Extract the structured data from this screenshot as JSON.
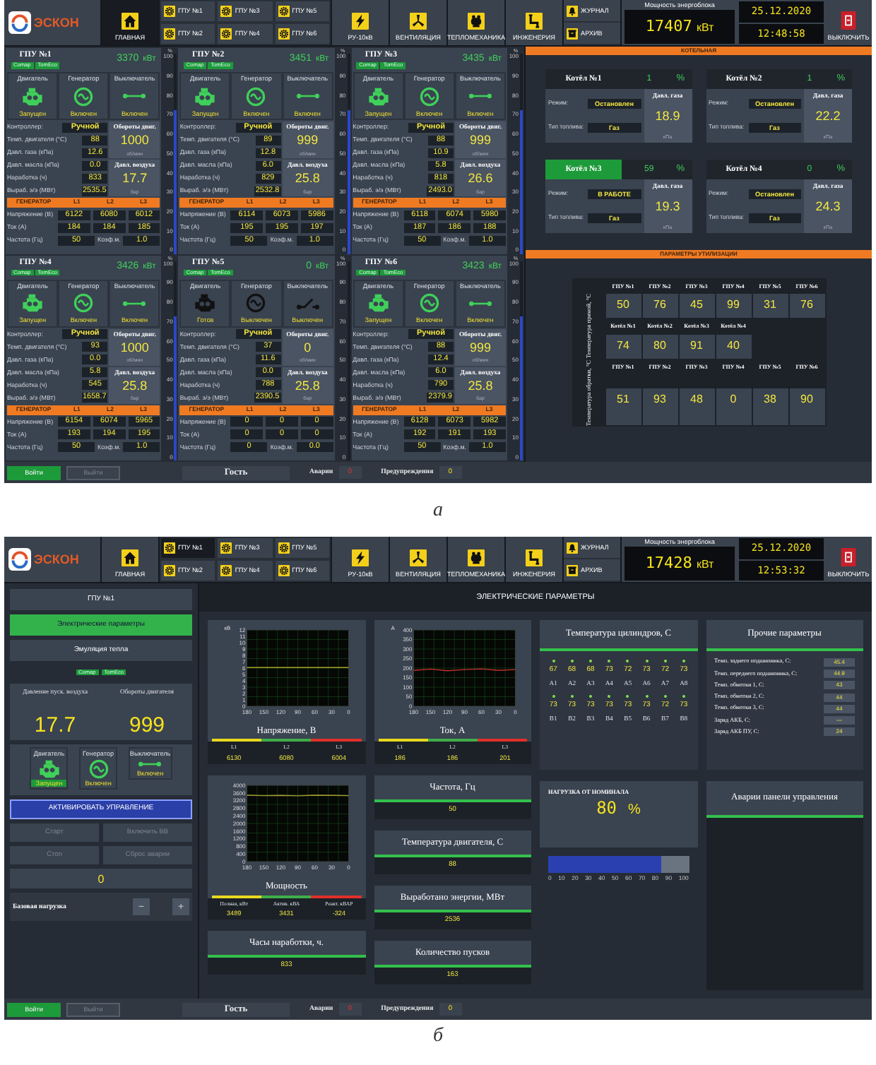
{
  "screen_a": {
    "header": {
      "logo": "ЭСКОН",
      "home": {
        "label": "ГЛАВНАЯ",
        "selected": true
      },
      "gpu_links": [
        {
          "label": "ГПУ №1",
          "selected": false
        },
        {
          "label": "ГПУ №3",
          "selected": false
        },
        {
          "label": "ГПУ №5",
          "selected": false
        },
        {
          "label": "ГПУ №2",
          "selected": false
        },
        {
          "label": "ГПУ №4",
          "selected": false
        },
        {
          "label": "ГПУ №6",
          "selected": false
        }
      ],
      "sections": [
        {
          "kind": "bolt",
          "label": "РУ-10кВ"
        },
        {
          "kind": "fan",
          "label": "ВЕНТИЛЯЦИЯ"
        },
        {
          "kind": "boiler",
          "label": "ТЕПЛОМЕХАНИКА"
        },
        {
          "kind": "pipe",
          "label": "ИНЖЕНЕРИЯ"
        }
      ],
      "logs": [
        {
          "kind": "bell",
          "label": "ЖУРНАЛ"
        },
        {
          "kind": "archive",
          "label": "АРХИВ"
        }
      ],
      "power": {
        "label": "Мощность энергоблока",
        "value": "17407",
        "unit": "кВт"
      },
      "date": "25.12.2020",
      "time": "12:48:58",
      "shutdown": "ВЫКЛЮЧИТЬ"
    },
    "gpus": [
      {
        "title": "ГПУ №1",
        "power": "3370",
        "unit": "кВт",
        "tags": [
          "Comap",
          "TomEco"
        ],
        "devices": [
          {
            "kind": "engine",
            "label": "Двигатель",
            "status": "Запущен",
            "active": true
          },
          {
            "kind": "generator",
            "label": "Генератор",
            "status": "Включен",
            "active": true
          },
          {
            "kind": "breaker",
            "label": "Выключатель",
            "status": "Включен",
            "active": true
          }
        ],
        "controller": {
          "label": "Контроллер:",
          "value": "Ручной"
        },
        "params": [
          {
            "label": "Темп. двигателя (°C)",
            "value": "88"
          },
          {
            "label": "Давл. газа (кПа)",
            "value": "12.6"
          },
          {
            "label": "Давл. масла (кПа)",
            "value": "0.0"
          },
          {
            "label": "Наработка (ч)",
            "value": "833"
          },
          {
            "label": "Выраб. э/э (МВт)",
            "value": "2535.5"
          }
        ],
        "side": [
          {
            "label": "Обороты двиг.",
            "value": "1000",
            "unit": "об/мин"
          },
          {
            "label": "Давл. воздуха",
            "value": "17.7",
            "unit": "бар"
          }
        ],
        "generator": [
          "ГЕНЕРАТОР",
          "L1",
          "L2",
          "L3"
        ],
        "lines": [
          {
            "label": "Напряжение (В)",
            "values": [
              "6122",
              "6080",
              "6012"
            ]
          },
          {
            "label": "Ток (А)",
            "values": [
              "184",
              "184",
              "185"
            ]
          }
        ],
        "freq": {
          "label": "Частота (Гц)",
          "value": "50",
          "coef_label": "Коэф.м.",
          "coef": "1.0"
        },
        "scale": {
          "unit": "%",
          "ticks": [
            "100",
            "90",
            "80",
            "70",
            "60",
            "50",
            "40",
            "30",
            "20",
            "10",
            "0"
          ],
          "level": 0.72
        }
      },
      {
        "title": "ГПУ №2",
        "power": "3451",
        "unit": "кВт",
        "tags": [
          "Comap",
          "TomEco"
        ],
        "devices": [
          {
            "kind": "engine",
            "label": "Двигатель",
            "status": "Запущен",
            "active": true
          },
          {
            "kind": "generator",
            "label": "Генератор",
            "status": "Включен",
            "active": true
          },
          {
            "kind": "breaker",
            "label": "Выключатель",
            "status": "Включен",
            "active": true
          }
        ],
        "controller": {
          "label": "Контроллер:",
          "value": "Ручной"
        },
        "params": [
          {
            "label": "Темп. двигателя (°C)",
            "value": "89"
          },
          {
            "label": "Давл. газа (кПа)",
            "value": "12.8"
          },
          {
            "label": "Давл. масла (кПа)",
            "value": "6.0"
          },
          {
            "label": "Наработка (ч)",
            "value": "829"
          },
          {
            "label": "Выраб. э/э (МВт)",
            "value": "2532.8"
          }
        ],
        "side": [
          {
            "label": "Обороты двиг.",
            "value": "999",
            "unit": "об/мин"
          },
          {
            "label": "Давл. воздуха",
            "value": "25.8",
            "unit": "бар"
          }
        ],
        "generator": [
          "ГЕНЕРАТОР",
          "L1",
          "L2",
          "L3"
        ],
        "lines": [
          {
            "label": "Напряжение (В)",
            "values": [
              "6114",
              "6073",
              "5986"
            ]
          },
          {
            "label": "Ток (А)",
            "values": [
              "195",
              "195",
              "197"
            ]
          }
        ],
        "freq": {
          "label": "Частота (Гц)",
          "value": "50",
          "coef_label": "Коэф.м.",
          "coef": "1.0"
        },
        "scale": {
          "unit": "%",
          "ticks": [
            "100",
            "90",
            "80",
            "70",
            "60",
            "50",
            "40",
            "30",
            "20",
            "10",
            "0"
          ],
          "level": 0.72
        }
      },
      {
        "title": "ГПУ №3",
        "power": "3435",
        "unit": "кВт",
        "tags": [
          "Comap",
          "TomEco"
        ],
        "devices": [
          {
            "kind": "engine",
            "label": "Двигатель",
            "status": "Запущен",
            "active": true
          },
          {
            "kind": "generator",
            "label": "Генератор",
            "status": "Включен",
            "active": true
          },
          {
            "kind": "breaker",
            "label": "Выключатель",
            "status": "Включен",
            "active": true
          }
        ],
        "controller": {
          "label": "Контроллер:",
          "value": "Ручной"
        },
        "params": [
          {
            "label": "Темп. двигателя (°C)",
            "value": "88"
          },
          {
            "label": "Давл. газа (кПа)",
            "value": "10.9"
          },
          {
            "label": "Давл. масла (кПа)",
            "value": "5.8"
          },
          {
            "label": "Наработка (ч)",
            "value": "818"
          },
          {
            "label": "Выраб. э/э (МВт)",
            "value": "2493.0"
          }
        ],
        "side": [
          {
            "label": "Обороты двиг.",
            "value": "999",
            "unit": "об/мин"
          },
          {
            "label": "Давл. воздуха",
            "value": "26.6",
            "unit": "бар"
          }
        ],
        "generator": [
          "ГЕНЕРАТОР",
          "L1",
          "L2",
          "L3"
        ],
        "lines": [
          {
            "label": "Напряжение (В)",
            "values": [
              "6118",
              "6074",
              "5980"
            ]
          },
          {
            "label": "Ток (А)",
            "values": [
              "187",
              "186",
              "188"
            ]
          }
        ],
        "freq": {
          "label": "Частота (Гц)",
          "value": "50",
          "coef_label": "Коэф.м.",
          "coef": "1.0"
        },
        "scale": {
          "unit": "%",
          "ticks": [
            "100",
            "90",
            "80",
            "70",
            "60",
            "50",
            "40",
            "30",
            "20",
            "10",
            "0"
          ],
          "level": 0.72
        }
      },
      {
        "title": "ГПУ №4",
        "power": "3426",
        "unit": "кВт",
        "tags": [
          "Comap",
          "TomEco"
        ],
        "devices": [
          {
            "kind": "engine",
            "label": "Двигатель",
            "status": "Запущен",
            "active": true
          },
          {
            "kind": "generator",
            "label": "Генератор",
            "status": "Включен",
            "active": true
          },
          {
            "kind": "breaker",
            "label": "Выключатель",
            "status": "Включен",
            "active": true
          }
        ],
        "controller": {
          "label": "Контроллер:",
          "value": "Ручной"
        },
        "params": [
          {
            "label": "Темп. двигателя (°C)",
            "value": "93"
          },
          {
            "label": "Давл. газа (кПа)",
            "value": "0.0"
          },
          {
            "label": "Давл. масла (кПа)",
            "value": "5.8"
          },
          {
            "label": "Наработка (ч)",
            "value": "545"
          },
          {
            "label": "Выраб. э/э (МВт)",
            "value": "1658.7"
          }
        ],
        "side": [
          {
            "label": "Обороты двиг.",
            "value": "1000",
            "unit": "об/мин"
          },
          {
            "label": "Давл. воздуха",
            "value": "25.8",
            "unit": "бар"
          }
        ],
        "generator": [
          "ГЕНЕРАТОР",
          "L1",
          "L2",
          "L3"
        ],
        "lines": [
          {
            "label": "Напряжение (В)",
            "values": [
              "6154",
              "6074",
              "5965"
            ]
          },
          {
            "label": "Ток (А)",
            "values": [
              "193",
              "194",
              "195"
            ]
          }
        ],
        "freq": {
          "label": "Частота (Гц)",
          "value": "50",
          "coef_label": "Коэф.м.",
          "coef": "1.0"
        },
        "scale": {
          "unit": "%",
          "ticks": [
            "100",
            "90",
            "80",
            "70",
            "60",
            "50",
            "40",
            "30",
            "20",
            "10",
            "0"
          ],
          "level": 0.72
        }
      },
      {
        "title": "ГПУ №5",
        "power": "0",
        "unit": "кВт",
        "tags": [
          "Comap",
          "TomEco"
        ],
        "devices": [
          {
            "kind": "engine",
            "label": "Двигатель",
            "status": "Готов",
            "active": false
          },
          {
            "kind": "generator",
            "label": "Генератор",
            "status": "Выключен",
            "active": false
          },
          {
            "kind": "breaker",
            "label": "Выключатель",
            "status": "Выключен",
            "active": false
          }
        ],
        "controller": {
          "label": "Контроллер:",
          "value": "Ручной"
        },
        "params": [
          {
            "label": "Темп. двигателя (°C)",
            "value": "37"
          },
          {
            "label": "Давл. газа (кПа)",
            "value": "11.6"
          },
          {
            "label": "Давл. масла (кПа)",
            "value": "0.0"
          },
          {
            "label": "Наработка (ч)",
            "value": "788"
          },
          {
            "label": "Выраб. э/э (МВт)",
            "value": "2390.5"
          }
        ],
        "side": [
          {
            "label": "Обороты двиг.",
            "value": "0",
            "unit": "об/мин"
          },
          {
            "label": "Давл. воздуха",
            "value": "25.8",
            "unit": "бар"
          }
        ],
        "generator": [
          "ГЕНЕРАТОР",
          "L1",
          "L2",
          "L3"
        ],
        "lines": [
          {
            "label": "Напряжение (В)",
            "values": [
              "0",
              "0",
              "0"
            ]
          },
          {
            "label": "Ток (А)",
            "values": [
              "0",
              "0",
              "0"
            ]
          }
        ],
        "freq": {
          "label": "Частота (Гц)",
          "value": "0",
          "coef_label": "Коэф.м.",
          "coef": "0.0"
        },
        "scale": {
          "unit": "%",
          "ticks": [
            "100",
            "90",
            "80",
            "70",
            "60",
            "50",
            "40",
            "30",
            "20",
            "10",
            "0"
          ],
          "level": 0
        }
      },
      {
        "title": "ГПУ №6",
        "power": "3423",
        "unit": "кВт",
        "tags": [
          "Comap",
          "TomEco"
        ],
        "devices": [
          {
            "kind": "engine",
            "label": "Двигатель",
            "status": "Запущен",
            "active": true
          },
          {
            "kind": "generator",
            "label": "Генератор",
            "status": "Включен",
            "active": true
          },
          {
            "kind": "breaker",
            "label": "Выключатель",
            "status": "Включен",
            "active": true
          }
        ],
        "controller": {
          "label": "Контроллер:",
          "value": "Ручной"
        },
        "params": [
          {
            "label": "Темп. двигателя (°C)",
            "value": "88"
          },
          {
            "label": "Давл. газа (кПа)",
            "value": "12.4"
          },
          {
            "label": "Давл. масла (кПа)",
            "value": "6.0"
          },
          {
            "label": "Наработка (ч)",
            "value": "790"
          },
          {
            "label": "Выраб. э/э (МВт)",
            "value": "2379.9"
          }
        ],
        "side": [
          {
            "label": "Обороты двиг.",
            "value": "999",
            "unit": "об/мин"
          },
          {
            "label": "Давл. воздуха",
            "value": "25.8",
            "unit": "бар"
          }
        ],
        "generator": [
          "ГЕНЕРАТОР",
          "L1",
          "L2",
          "L3"
        ],
        "lines": [
          {
            "label": "Напряжение (В)",
            "values": [
              "6128",
              "6073",
              "5982"
            ]
          },
          {
            "label": "Ток (А)",
            "values": [
              "192",
              "191",
              "193"
            ]
          }
        ],
        "freq": {
          "label": "Частота (Гц)",
          "value": "50",
          "coef_label": "Коэф.м.",
          "coef": "1.0"
        },
        "scale": {
          "unit": "%",
          "ticks": [
            "100",
            "90",
            "80",
            "70",
            "60",
            "50",
            "40",
            "30",
            "20",
            "10",
            "0"
          ],
          "level": 0.72
        }
      }
    ],
    "boiler_room": {
      "title": "КОТЕЛЬНАЯ",
      "boilers": [
        {
          "name": "Котёл №1",
          "value": "1",
          "unit": "%",
          "running": false,
          "rows": [
            {
              "label": "Режим:",
              "value": "Остановлен"
            },
            {
              "label": "Тип топлива:",
              "value": "Газ"
            }
          ],
          "gas": {
            "label": "Давл. газа",
            "value": "18.9",
            "unit": "кПа"
          }
        },
        {
          "name": "Котёл №2",
          "value": "1",
          "unit": "%",
          "running": false,
          "rows": [
            {
              "label": "Режим:",
              "value": "Остановлен"
            },
            {
              "label": "Тип топлива:",
              "value": "Газ"
            }
          ],
          "gas": {
            "label": "Давл. газа",
            "value": "22.2",
            "unit": "кПа"
          }
        },
        {
          "name": "Котёл №3",
          "value": "59",
          "unit": "%",
          "running": true,
          "rows": [
            {
              "label": "Режим:",
              "value": "В РАБОТЕ"
            },
            {
              "label": "Тип топлива:",
              "value": "Газ"
            }
          ],
          "gas": {
            "label": "Давл. газа",
            "value": "19.3",
            "unit": "кПа"
          }
        },
        {
          "name": "Котёл №4",
          "value": "0",
          "unit": "%",
          "running": false,
          "rows": [
            {
              "label": "Режим:",
              "value": "Остановлен"
            },
            {
              "label": "Тип топлива:",
              "value": "Газ"
            }
          ],
          "gas": {
            "label": "Давл. газа",
            "value": "24.3",
            "unit": "кПа"
          }
        }
      ]
    },
    "utilization": {
      "title": "ПАРАМЕТРЫ УТИЛИЗАЦИИ",
      "supply": {
        "label": "Температура прямой, °С",
        "gpu_headers": [
          "ГПУ №1",
          "ГПУ №2",
          "ГПУ №3",
          "ГПУ №4",
          "ГПУ №5",
          "ГПУ №6"
        ],
        "gpu_values": [
          "50",
          "76",
          "45",
          "99",
          "31",
          "76"
        ],
        "boiler_headers": [
          "Котёл №1",
          "Котёл №2",
          "Котёл №3",
          "Котёл №4"
        ],
        "boiler_values": [
          "74",
          "80",
          "91",
          "40"
        ]
      },
      "return": {
        "label": "Температура обратки, °С",
        "gpu_headers": [
          "ГПУ №1",
          "ГПУ №2",
          "ГПУ №3",
          "ГПУ №4",
          "ГПУ №5",
          "ГПУ №6"
        ],
        "gpu_values": [
          "51",
          "93",
          "48",
          "0",
          "38",
          "90"
        ]
      }
    },
    "footer": {
      "login": {
        "label": "Войти",
        "disabled": false
      },
      "logout": {
        "label": "Выйти",
        "disabled": true
      },
      "user": "Гость",
      "alarms": {
        "label": "Аварии",
        "value": "0"
      },
      "warnings": {
        "label": "Предупреждения",
        "value": "0"
      }
    },
    "caption": "а"
  },
  "screen_b": {
    "header": {
      "logo": "ЭСКОН",
      "home": {
        "label": "ГЛАВНАЯ",
        "selected": false
      },
      "gpu_links": [
        {
          "label": "ГПУ №1",
          "selected": true
        },
        {
          "label": "ГПУ №3",
          "selected": false
        },
        {
          "label": "ГПУ №5",
          "selected": false
        },
        {
          "label": "ГПУ №2",
          "selected": false
        },
        {
          "label": "ГПУ №4",
          "selected": false
        },
        {
          "label": "ГПУ №6",
          "selected": false
        }
      ],
      "sections": [
        {
          "kind": "bolt",
          "label": "РУ-10кВ"
        },
        {
          "kind": "fan",
          "label": "ВЕНТИЛЯЦИЯ"
        },
        {
          "kind": "boiler",
          "label": "ТЕПЛОМЕХАНИКА"
        },
        {
          "kind": "pipe",
          "label": "ИНЖЕНЕРИЯ"
        }
      ],
      "logs": [
        {
          "kind": "bell",
          "label": "ЖУРНАЛ"
        },
        {
          "kind": "archive",
          "label": "АРХИВ"
        }
      ],
      "power": {
        "label": "Мощность энергоблока",
        "value": "17428",
        "unit": "кВт"
      },
      "date": "25.12.2020",
      "time": "12:53:32",
      "shutdown": "ВЫКЛЮЧИТЬ"
    },
    "left": {
      "title": "ГПУ №1",
      "tabs": [
        {
          "label": "Электрические параметры",
          "selected": true
        },
        {
          "label": "Эмуляция тепла",
          "selected": false
        }
      ],
      "tags": [
        "Comap",
        "TomEco"
      ],
      "readings": [
        {
          "label": "Давление пуск. воздуха",
          "value": "17.7"
        },
        {
          "label": "Обороты двигателя",
          "value": "999"
        }
      ],
      "devices": [
        {
          "kind": "engine",
          "label": "Двигатель",
          "status": "Запущен",
          "active": true,
          "highlighted": true
        },
        {
          "kind": "generator",
          "label": "Генератор",
          "status": "Включен",
          "active": true,
          "highlighted": false
        },
        {
          "kind": "breaker",
          "label": "Выключатель",
          "status": "Включен",
          "active": true,
          "highlighted": false
        }
      ],
      "activate": "АКТИВИРОВАТЬ УПРАВЛЕНИЕ",
      "controls": [
        {
          "label": "Старт",
          "disabled": true
        },
        {
          "label": "Включить ВВ",
          "disabled": true
        },
        {
          "label": "Стоп",
          "disabled": true
        },
        {
          "label": "Сброс аварии",
          "disabled": true
        }
      ],
      "setpoint": "0",
      "base_load": {
        "label": "Базовая нагрузка",
        "minus": "−",
        "plus": "+"
      }
    },
    "main": {
      "title": "ЭЛЕКТРИЧЕСКИЕ ПАРАМЕТРЫ",
      "column_1": [
        {
          "kind": "chart",
          "title": "Напряжение, В",
          "chart_data": {
            "type": "line",
            "grid": true,
            "ylabel": "кВ",
            "x": [
              180,
              150,
              120,
              90,
              60,
              30,
              0
            ],
            "xlim": [
              180,
              0
            ],
            "ylim": [
              0,
              12
            ],
            "xticks": [
              180,
              150,
              120,
              90,
              60,
              30,
              0
            ],
            "yticks": [
              0,
              1,
              2,
              3,
              4,
              5,
              6,
              7,
              8,
              9,
              10,
              11,
              12
            ],
            "series": [
              {
                "color": "#c8c02a",
                "values": [
                  6.1,
                  6.1,
                  6.1,
                  6.1,
                  6.1,
                  6.1,
                  6.1
                ]
              }
            ]
          },
          "legend": [
            {
              "label": "L1",
              "value": "6130",
              "color": "#e8d81e"
            },
            {
              "label": "L2",
              "value": "6080",
              "color": "#3fae49"
            },
            {
              "label": "L3",
              "value": "6004",
              "color": "#e0302a"
            }
          ]
        },
        {
          "kind": "chart",
          "title": "Мощность",
          "chart_data": {
            "type": "line",
            "grid": true,
            "x": [
              180,
              150,
              120,
              90,
              60,
              30,
              0
            ],
            "xlim": [
              180,
              0
            ],
            "ylim": [
              0,
              4000
            ],
            "xticks": [
              180,
              150,
              120,
              90,
              60,
              30,
              0
            ],
            "yticks": [
              0,
              400,
              800,
              1200,
              1600,
              2000,
              2400,
              2800,
              3200,
              3600,
              4000
            ],
            "series": [
              {
                "color": "#a89a30",
                "values": [
                  3480,
                  3460,
                  3470,
                  3450,
                  3480,
                  3470,
                  3460
                ]
              }
            ]
          },
          "legend": [
            {
              "label": "Полная, кВт",
              "value": "3489",
              "color": "#e8d81e"
            },
            {
              "label": "Актив. кВА",
              "value": "3431",
              "color": "#3fae49"
            },
            {
              "label": "Реакт. кВАР",
              "value": "-324",
              "color": "#e0302a"
            }
          ]
        },
        {
          "kind": "tile",
          "title": "Часы наработки, ч.",
          "value": "833"
        }
      ],
      "column_2": [
        {
          "kind": "chart",
          "title": "Ток, А",
          "chart_data": {
            "type": "line",
            "grid": true,
            "ylabel": "А",
            "x": [
              180,
              150,
              120,
              90,
              60,
              30,
              0
            ],
            "xlim": [
              180,
              0
            ],
            "ylim": [
              0,
              400
            ],
            "xticks": [
              180,
              150,
              120,
              90,
              60,
              30,
              0
            ],
            "yticks": [
              0,
              50,
              100,
              150,
              200,
              250,
              300,
              350,
              400
            ],
            "series": [
              {
                "color": "#c8302a",
                "values": [
                  188,
                  195,
                  186,
                  192,
                  196,
                  188,
                  192
                ]
              }
            ]
          },
          "legend": [
            {
              "label": "L1",
              "value": "186",
              "color": "#e8d81e"
            },
            {
              "label": "L2",
              "value": "186",
              "color": "#3fae49"
            },
            {
              "label": "L3",
              "value": "201",
              "color": "#e0302a"
            }
          ]
        },
        {
          "kind": "tile",
          "title": "Частота, Гц",
          "value": "50"
        },
        {
          "kind": "tile",
          "title": "Температура двигателя, С",
          "value": "88"
        },
        {
          "kind": "tile",
          "title": "Выработано энергии, МВт",
          "value": "2536"
        },
        {
          "kind": "tile",
          "title": "Количество пусков",
          "value": "163"
        }
      ],
      "cylinders": {
        "title": "Температура цилиндров, С",
        "rows": [
          {
            "values": [
              "67",
              "68",
              "68",
              "73",
              "72",
              "73",
              "72",
              "73"
            ],
            "labels": [
              "A1",
              "A2",
              "A3",
              "A4",
              "A5",
              "A6",
              "A7",
              "A8"
            ]
          },
          {
            "values": [
              "73",
              "73",
              "73",
              "73",
              "73",
              "73",
              "72",
              "73"
            ],
            "labels": [
              "B1",
              "B2",
              "B3",
              "B4",
              "B5",
              "B6",
              "B7",
              "B8"
            ]
          }
        ]
      },
      "load": {
        "title": "НАГРУЗКА ОТ НОМИНАЛА",
        "value": "80",
        "unit": "%",
        "level": 0.8,
        "ticks": [
          "0",
          "10",
          "20",
          "30",
          "40",
          "50",
          "60",
          "70",
          "80",
          "90",
          "100"
        ]
      },
      "other": {
        "title": "Прочие параметры",
        "rows": [
          {
            "label": "Темп. заднего подшипника, С:",
            "value": "45.4"
          },
          {
            "label": "Темп. переднего подшипника, С:",
            "value": "44.9"
          },
          {
            "label": "Темп. обмотки 1, С:",
            "value": "43"
          },
          {
            "label": "Темп. обмотки 2, С:",
            "value": "44"
          },
          {
            "label": "Темп. обмотки 3, С:",
            "value": "44"
          },
          {
            "label": "Заряд АКБ, С:",
            "value": "—"
          },
          {
            "label": "Заряд АКБ ПУ, С:",
            "value": "24"
          }
        ]
      },
      "alarms_panel": {
        "title": "Аварии панели управления"
      }
    },
    "footer": {
      "login": {
        "label": "Войти",
        "disabled": false
      },
      "logout": {
        "label": "Выйти",
        "disabled": true
      },
      "user": "Гость",
      "alarms": {
        "label": "Аварии",
        "value": "0"
      },
      "warnings": {
        "label": "Предупреждения",
        "value": "0"
      }
    },
    "caption": "б"
  }
}
